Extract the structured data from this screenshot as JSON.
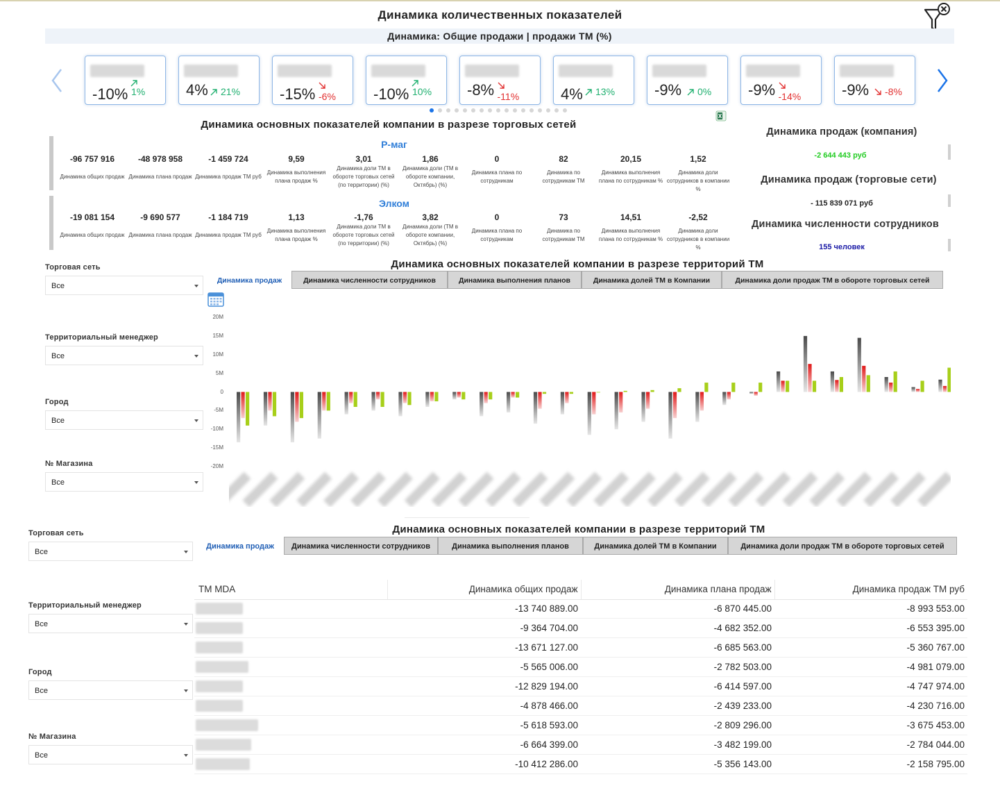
{
  "header": {
    "title": "Динамика количественных показателей",
    "subtitle": "Динамика: Общие продажи  | продажи ТМ (%)"
  },
  "carousel": {
    "cards": [
      {
        "value": "-10%",
        "trend": "1%",
        "dir": "up"
      },
      {
        "value": "4%",
        "trend": "21%",
        "dir": "up"
      },
      {
        "value": "-15%",
        "trend": "-6%",
        "dir": "down"
      },
      {
        "value": "-10%",
        "trend": "10%",
        "dir": "up"
      },
      {
        "value": "-8%",
        "trend": "-11%",
        "dir": "down"
      },
      {
        "value": "4%",
        "trend": "13%",
        "dir": "up"
      },
      {
        "value": "-9%",
        "trend": "0%",
        "dir": "up"
      },
      {
        "value": "-9%",
        "trend": "-14%",
        "dir": "down"
      },
      {
        "value": "-9%",
        "trend": "-8%",
        "dir": "down"
      }
    ],
    "page_count": 17,
    "active_page": 1
  },
  "networks_section": {
    "title": "Динамика основных показателей компании в разрезе торговых сетей",
    "networks": [
      {
        "name": "Р-маг",
        "metrics": [
          {
            "value": "-96 757 916",
            "label": "Динамика общих продаж"
          },
          {
            "value": "-48 978 958",
            "label": "Динамика плана продаж"
          },
          {
            "value": "-1 459 724",
            "label": "Динамика продаж ТМ руб"
          },
          {
            "value": "9,59",
            "label": "Динамика выполнения плана продаж %"
          },
          {
            "value": "3,01",
            "label": "Динамика доли ТМ в обороте торговых сетей (по территории) (%)"
          },
          {
            "value": "1,86",
            "label": "Динамика доли (ТМ в обороте компании, Октябрь) (%)"
          },
          {
            "value": "0",
            "label": "Динамика плана по сотрудникам"
          },
          {
            "value": "82",
            "label": "Динамика по сотрудникам ТМ"
          },
          {
            "value": "20,15",
            "label": "Динамика выполнения плана по сотрудникам %"
          },
          {
            "value": "1,52",
            "label": "Динамика доли сотрудников в компании %"
          }
        ]
      },
      {
        "name": "Элком",
        "metrics": [
          {
            "value": "-19 081 154",
            "label": "Динамика общих продаж"
          },
          {
            "value": "-9 690 577",
            "label": "Динамика плана продаж"
          },
          {
            "value": "-1 184 719",
            "label": "Динамика продаж ТМ руб"
          },
          {
            "value": "1,13",
            "label": "Динамика выполнения плана продаж %"
          },
          {
            "value": "-1,76",
            "label": "Динамика доли ТМ в обороте торговых сетей (по территории) (%)"
          },
          {
            "value": "3,82",
            "label": "Динамика доли (ТМ в обороте компании, Октябрь) (%)"
          },
          {
            "value": "0",
            "label": "Динамика плана по сотрудникам"
          },
          {
            "value": "73",
            "label": "Динамика по сотрудникам ТМ"
          },
          {
            "value": "14,51",
            "label": "Динамика выполнения плана по сотрудникам %"
          },
          {
            "value": "-2,52",
            "label": "Динамика доли сотрудников в компании %"
          }
        ]
      }
    ]
  },
  "summary": {
    "company_title": "Динамика продаж (компания)",
    "company_value": "-2 644 443 руб",
    "networks_title": "Динамика продаж (торговые сети)",
    "networks_value": "- 115 839 071 руб",
    "staff_title": "Динамика численности сотрудников",
    "staff_value": "155 человек",
    "colors": {
      "company_value": "#22cc22",
      "staff_value": "#1a1aa6"
    }
  },
  "filters": {
    "network_label": "Торговая сеть",
    "manager_label": "Территориальный менеджер",
    "city_label": "Город",
    "store_label": "№ Магазина",
    "all_value": "Все"
  },
  "territory_section": {
    "title": "Динамика основных показателей компании в разрезе территорий ТМ",
    "tabs": [
      "Динамика продаж",
      "Динамика численности сотрудников",
      "Динамика выполнения планов",
      "Динамика долей ТМ в Компании",
      "Динамика доли продаж ТМ в обороте торговых сетей"
    ],
    "active_tab": 0
  },
  "chart_data": {
    "type": "bar",
    "y_ticks": [
      "20M",
      "15M",
      "10M",
      "5M",
      "0",
      "-5M",
      "-10M",
      "-15M",
      "-20M"
    ],
    "ylim": [
      -20,
      20
    ],
    "units": "M",
    "series": [
      {
        "color": "#555555",
        "values": [
          -13.5,
          -9,
          -13.5,
          -12.5,
          -6,
          -5,
          -6.5,
          -4,
          -2,
          -6.5,
          -5.5,
          -8.5,
          -6,
          -11.5,
          -10,
          -8,
          -12.5,
          -8,
          -3.5,
          -0.5,
          5.5,
          15,
          5.5,
          14.5,
          4,
          1.3,
          3.3
        ]
      },
      {
        "color": "#e02020",
        "values": [
          -7,
          -5,
          -8,
          -5,
          -3,
          -2,
          -3,
          -2.5,
          -1.5,
          -3,
          -1.5,
          -4.5,
          -3,
          -6,
          -5.5,
          -4.5,
          -7,
          -5,
          -2,
          -1,
          3,
          7.5,
          3.2,
          7,
          2.5,
          0.8,
          1.6
        ]
      },
      {
        "color": "#a7cf1a",
        "values": [
          -9,
          -6.5,
          -7,
          -5,
          -4,
          -4,
          -3.5,
          -2.5,
          -2,
          -2,
          -1.5,
          -0.5,
          -0.5,
          0,
          0.3,
          0.5,
          1,
          2.5,
          2.5,
          2.5,
          3,
          3,
          4,
          4.5,
          5.5,
          3,
          6.5
        ]
      }
    ]
  },
  "table_section": {
    "title": "Динамика основных показателей компании в разрезе территорий ТМ",
    "columns": [
      "ТМ MDA",
      "Динамика общих продаж",
      "Динамика плана продаж",
      "Динамика продаж ТМ руб"
    ],
    "rows": [
      [
        "-13 740 889.00",
        "-6 870 445.00",
        "-8 993 553.00"
      ],
      [
        "-9 364 704.00",
        "-4 682 352.00",
        "-6 553 395.00"
      ],
      [
        "-13 671 127.00",
        "-6 685 563.00",
        "-5 360 767.00"
      ],
      [
        "-5 565 006.00",
        "-2 782 503.00",
        "-4 981 079.00"
      ],
      [
        "-12 829 194.00",
        "-6 414 597.00",
        "-4 747 974.00"
      ],
      [
        "-4 878 466.00",
        "-2 439 233.00",
        "-4 230 716.00"
      ],
      [
        "-5 618 593.00",
        "-2 809 296.00",
        "-3 675 453.00"
      ],
      [
        "-6 664 399.00",
        "-3 482 199.00",
        "-2 784 044.00"
      ],
      [
        "-10 412 286.00",
        "-5 356 143.00",
        "-2 158 795.00"
      ]
    ]
  },
  "icons": {
    "filter": "filter-clear-icon",
    "prev": "chevron-left-icon",
    "next": "chevron-right-icon",
    "excel": "excel-export-icon",
    "calendar": "calendar-icon",
    "trend_up": "arrow-up-right-icon",
    "trend_down": "arrow-down-right-icon"
  },
  "colors": {
    "up": "#20b070",
    "down": "#e23030",
    "accent": "#1a73e8",
    "card_border": "#8fb7e6"
  }
}
